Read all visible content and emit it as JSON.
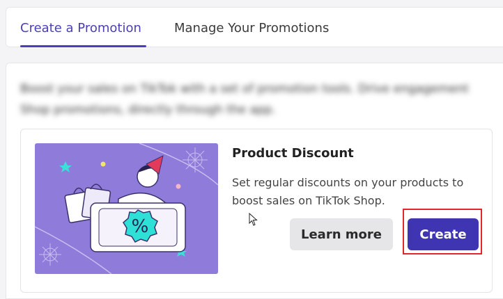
{
  "tabs": [
    {
      "label": "Create a Promotion",
      "active": true
    },
    {
      "label": "Manage Your Promotions",
      "active": false
    }
  ],
  "intro": {
    "line1": "Boost your sales on TikTok with a set of promotion tools. Drive engagement",
    "line2": "Shop promotions, directly through the app."
  },
  "promotion": {
    "title": "Product Discount",
    "description": "Set regular discounts on your products to boost sales on TikTok Shop.",
    "learn_more_label": "Learn more",
    "create_label": "Create",
    "illustration_glyph": "%"
  },
  "colors": {
    "accent": "#4a3fb6",
    "create_button": "#3f35b3",
    "illustration_bg": "#8f7bd9",
    "highlight": "#e0262a"
  },
  "icons": {
    "cursor": "mouse-pointer-icon"
  }
}
